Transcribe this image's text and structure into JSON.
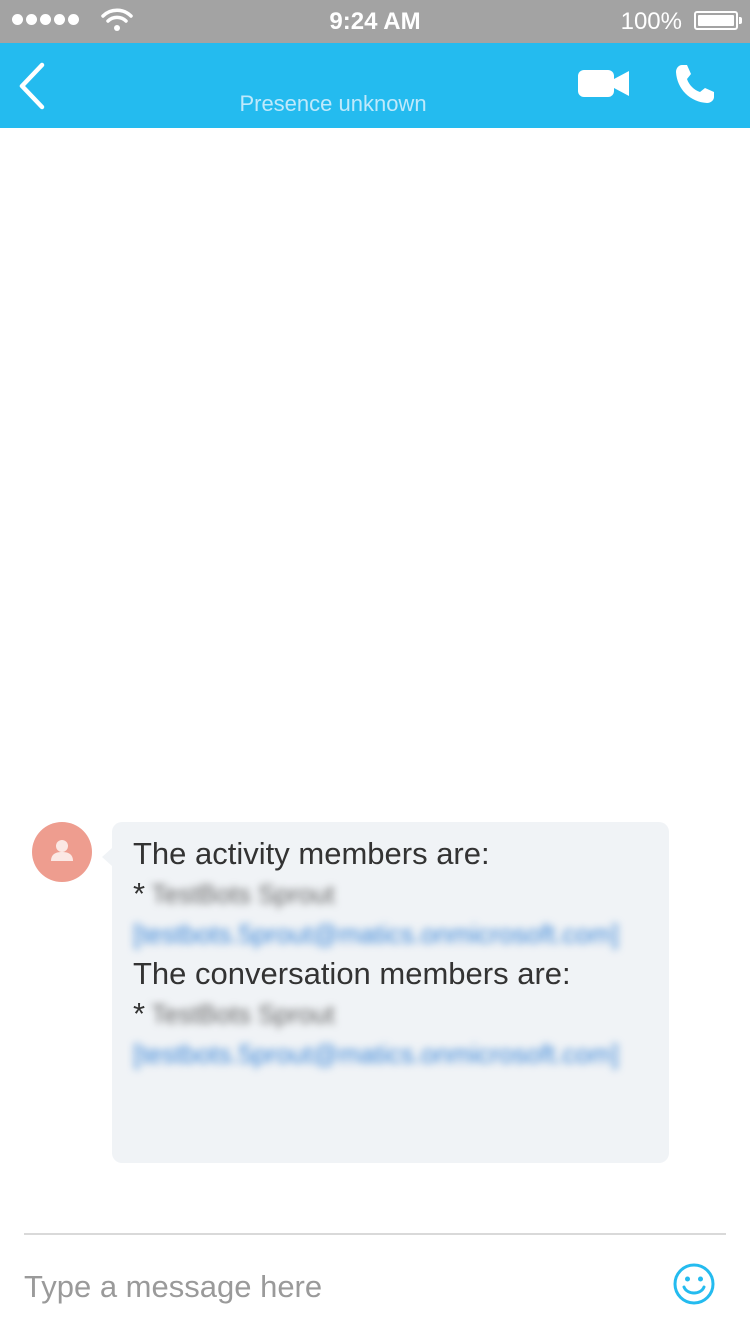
{
  "status_bar": {
    "time": "9:24 AM",
    "battery_percent": "100%",
    "signal_bars": 5
  },
  "header": {
    "presence": "Presence unknown",
    "back_icon": "chevron-left-icon",
    "video_icon": "video-camera-icon",
    "call_icon": "phone-icon"
  },
  "message": {
    "activity_heading": "The activity members are:",
    "conversation_heading": "The conversation members are:",
    "bullet": "*",
    "member_name_redacted": "TestBots Sprout",
    "member_email_redacted": "[testbots.5prout@matics.onmicrosoft.com]"
  },
  "compose": {
    "placeholder": "Type a message here",
    "emoji_icon": "smiley-icon"
  },
  "colors": {
    "header_bg": "#24bbef",
    "status_bg": "#a3a3a3",
    "bubble_bg": "#f0f3f6",
    "avatar_bg": "#ee9d8f",
    "accent": "#24bbef"
  }
}
